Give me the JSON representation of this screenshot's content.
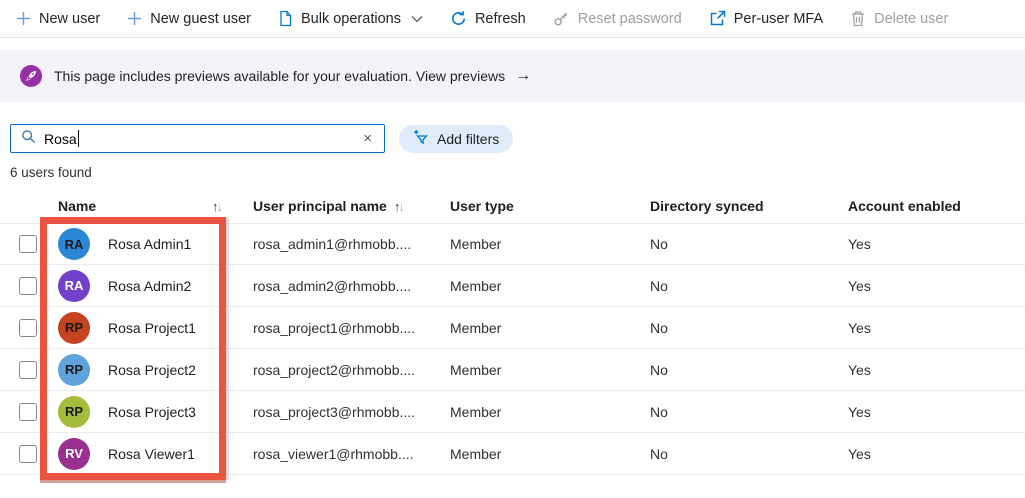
{
  "toolbar": {
    "items": [
      {
        "label": "New user",
        "icon": "plus-icon",
        "enabled": true,
        "has_dropdown": false
      },
      {
        "label": "New guest user",
        "icon": "plus-icon",
        "enabled": true,
        "has_dropdown": false
      },
      {
        "label": "Bulk operations",
        "icon": "document-icon",
        "enabled": true,
        "has_dropdown": true
      },
      {
        "label": "Refresh",
        "icon": "refresh-icon",
        "enabled": true,
        "has_dropdown": false
      },
      {
        "label": "Reset password",
        "icon": "key-icon",
        "enabled": false,
        "has_dropdown": false
      },
      {
        "label": "Per-user MFA",
        "icon": "external-link-icon",
        "enabled": true,
        "has_dropdown": false
      },
      {
        "label": "Delete user",
        "icon": "trash-icon",
        "enabled": false,
        "has_dropdown": false
      }
    ],
    "accent_color": "#0078d4",
    "disabled_color": "#a19f9d"
  },
  "banner": {
    "message": "This page includes previews available for your evaluation. View previews",
    "arrow": "→",
    "icon_color": "#9730a8",
    "background_color": "#f5f3fa"
  },
  "search": {
    "value": "Rosa",
    "clear_icon": "×"
  },
  "filters": {
    "add_filters_label": "Add filters"
  },
  "results_count": "6 users found",
  "table": {
    "columns": [
      {
        "label": "Name",
        "sortable": true
      },
      {
        "label": "User principal name",
        "sortable": true
      },
      {
        "label": "User type",
        "sortable": false
      },
      {
        "label": "Directory synced",
        "sortable": false
      },
      {
        "label": "Account enabled",
        "sortable": false
      }
    ],
    "sort_up": "↑",
    "sort_down": "↓",
    "rows": [
      {
        "initials": "RA",
        "avatar_color": "#2b88d8",
        "initials_color": "#1b1a19",
        "name": "Rosa Admin1",
        "upn": "rosa_admin1@rhmobb....",
        "user_type": "Member",
        "directory_synced": "No",
        "account_enabled": "Yes"
      },
      {
        "initials": "RA",
        "avatar_color": "#7141c9",
        "initials_color": "#ffffff",
        "name": "Rosa Admin2",
        "upn": "rosa_admin2@rhmobb....",
        "user_type": "Member",
        "directory_synced": "No",
        "account_enabled": "Yes"
      },
      {
        "initials": "RP",
        "avatar_color": "#c5431f",
        "initials_color": "#1b1a19",
        "name": "Rosa Project1",
        "upn": "rosa_project1@rhmobb....",
        "user_type": "Member",
        "directory_synced": "No",
        "account_enabled": "Yes"
      },
      {
        "initials": "RP",
        "avatar_color": "#5ea3dc",
        "initials_color": "#1b1a19",
        "name": "Rosa Project2",
        "upn": "rosa_project2@rhmobb....",
        "user_type": "Member",
        "directory_synced": "No",
        "account_enabled": "Yes"
      },
      {
        "initials": "RP",
        "avatar_color": "#a2bd39",
        "initials_color": "#1b1a19",
        "name": "Rosa Project3",
        "upn": "rosa_project3@rhmobb....",
        "user_type": "Member",
        "directory_synced": "No",
        "account_enabled": "Yes"
      },
      {
        "initials": "RV",
        "avatar_color": "#99308f",
        "initials_color": "#ffffff",
        "name": "Rosa Viewer1",
        "upn": "rosa_viewer1@rhmobb....",
        "user_type": "Member",
        "directory_synced": "No",
        "account_enabled": "Yes"
      }
    ]
  },
  "annotation": {
    "color": "#ea5440"
  }
}
